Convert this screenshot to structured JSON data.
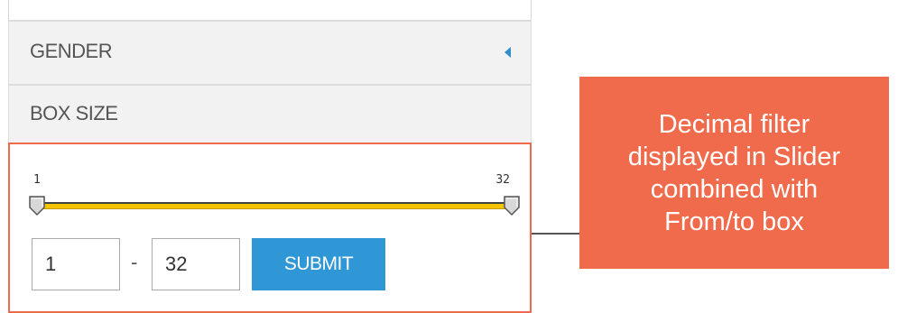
{
  "filters": {
    "gender": {
      "label": "GENDER",
      "icon": "caret-left-icon"
    },
    "box_size": {
      "label": "BOX SIZE"
    }
  },
  "slider": {
    "min_label": "1",
    "max_label": "32",
    "min_value": 1,
    "max_value": 32,
    "low": 1,
    "high": 32,
    "track_color": "#f5c400"
  },
  "range_inputs": {
    "from_value": "1",
    "to_value": "32",
    "separator": "-"
  },
  "submit_label": "SUBMIT",
  "annotation": {
    "text": "Decimal filter\ndisplayed in Slider\ncombined with\nFrom/to box",
    "color": "#f06a4c"
  },
  "colors": {
    "accent_blue": "#2f97d6",
    "highlight_border": "#f06a4c"
  }
}
